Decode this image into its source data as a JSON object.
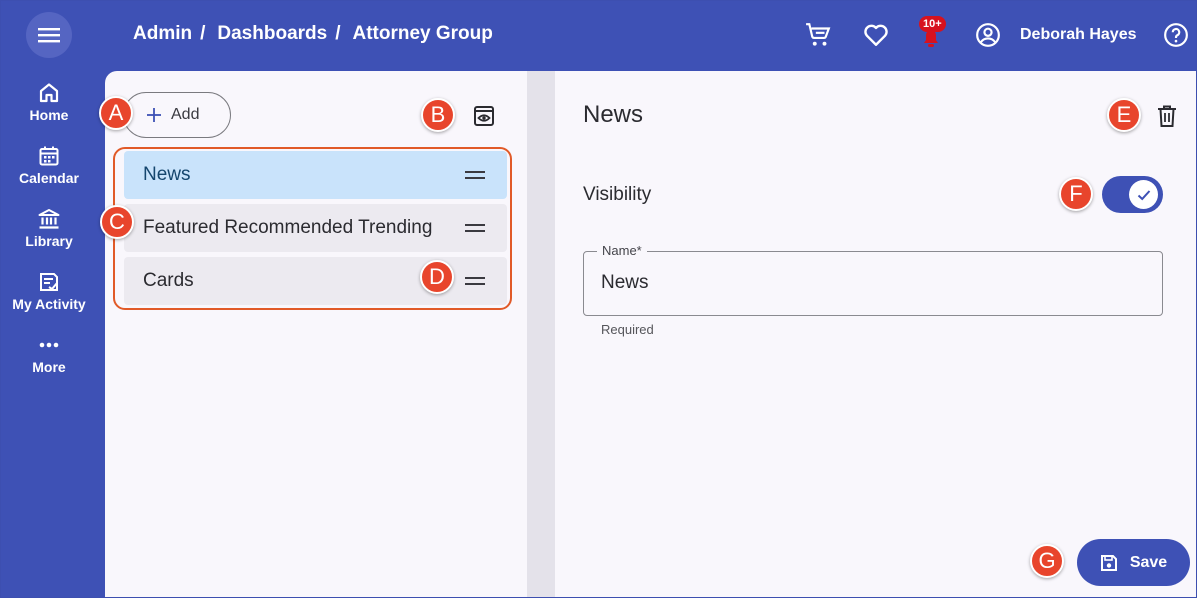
{
  "header": {
    "breadcrumbs": [
      "Admin",
      "/",
      "Dashboards",
      "/",
      "Attorney Group"
    ],
    "notification_count": "10+",
    "user_name": "Deborah Hayes"
  },
  "nav": {
    "items": [
      {
        "label": "Home",
        "icon": "home-icon"
      },
      {
        "label": "Calendar",
        "icon": "calendar-icon"
      },
      {
        "label": "Library",
        "icon": "library-icon"
      },
      {
        "label": "My Activity",
        "icon": "activity-icon"
      },
      {
        "label": "More",
        "icon": "more-icon"
      }
    ]
  },
  "left_panel": {
    "add_label": "Add",
    "sections": [
      {
        "label": "News",
        "selected": true
      },
      {
        "label": "Featured Recommended Trending",
        "selected": false
      },
      {
        "label": "Cards",
        "selected": false
      }
    ]
  },
  "detail": {
    "title": "News",
    "visibility_label": "Visibility",
    "visibility_on": true,
    "name_label": "Name*",
    "name_value": "News",
    "name_helper": "Required",
    "save_label": "Save"
  },
  "callouts": [
    "A",
    "B",
    "C",
    "D",
    "E",
    "F",
    "G"
  ],
  "colors": {
    "primary": "#3e51b5",
    "panel": "#f9f7fc",
    "selected": "#c9e3fb",
    "callout": "#e8452c",
    "outline": "#e15a28"
  }
}
